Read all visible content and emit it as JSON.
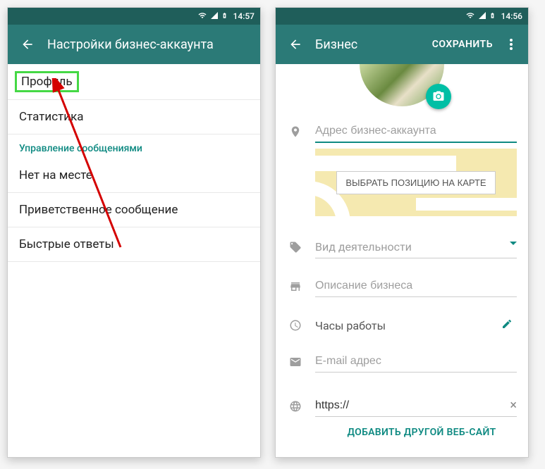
{
  "left": {
    "status_time": "14:57",
    "appbar_title": "Настройки бизнес-аккаунта",
    "items": {
      "profile": "Профиль",
      "stats": "Статистика",
      "section": "Управление сообщениями",
      "away": "Нет на месте",
      "greeting": "Приветственное сообщение",
      "quick": "Быстрые ответы"
    }
  },
  "right": {
    "status_time": "14:56",
    "appbar_title": "Бизнес",
    "appbar_action": "СОХРАНИТЬ",
    "fields": {
      "address_placeholder": "Адрес бизнес-аккаунта",
      "map_button": "ВЫБРАТЬ ПОЗИЦИЮ НА КАРТЕ",
      "category_placeholder": "Вид деятельности",
      "description_placeholder": "Описание бизнеса",
      "hours_label": "Часы работы",
      "email_placeholder": "E-mail адрес",
      "website_value": "https://",
      "add_website": "ДОБАВИТЬ ДРУГОЙ ВЕБ-САЙТ"
    }
  }
}
